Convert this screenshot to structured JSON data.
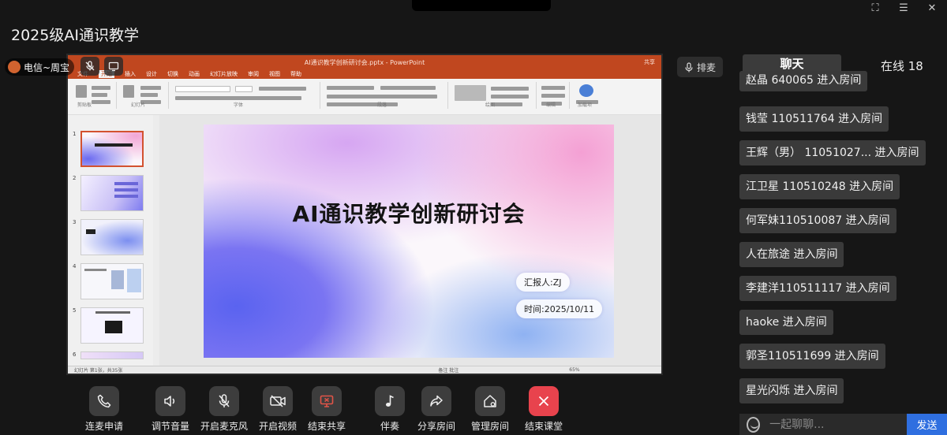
{
  "header": {
    "course_title": "2025级AI通识教学"
  },
  "presenter": {
    "name": "电信~周宝"
  },
  "ppt": {
    "window_title": "AI通识教学创新研讨会.pptx - PowerPoint",
    "share_label": "共享",
    "tabs": [
      "文件",
      "开始",
      "插入",
      "设计",
      "切换",
      "动画",
      "幻灯片放映",
      "审阅",
      "视图",
      "帮助"
    ],
    "ribbon_groups": [
      "剪贴板",
      "幻灯片",
      "字体",
      "段落",
      "绘图",
      "编辑",
      "加载项"
    ],
    "slide": {
      "title": "AI通识教学创新研讨会",
      "reporter": "汇报人:ZJ",
      "date": "时间:2025/10/11"
    },
    "thumbnail_numbers": [
      "1",
      "2",
      "3",
      "4",
      "5",
      "6"
    ],
    "status_left": "幻灯片 第1张，共35张",
    "status_right": "备注  批注",
    "zoom": "65%"
  },
  "side": {
    "raise_hand": "排麦",
    "chat_tab": "聊天",
    "online_label": "在线 18",
    "messages": [
      "赵晶 640065 进入房间",
      "钱莹 110511764 进入房间",
      "王辉（男） 11051027... 进入房间",
      "江卫星 110510248 进入房间",
      "何军妹110510087 进入房间",
      "人在旅途 进入房间",
      "李建洋110511117 进入房间",
      "haoke 进入房间",
      "郭圣110511699 进入房间",
      "星光闪烁 进入房间"
    ],
    "input_placeholder": "一起聊聊...",
    "send": "发送"
  },
  "controls": [
    {
      "label": "连麦申请",
      "icon": "phone-icon"
    },
    {
      "label": "调节音量",
      "icon": "speaker-icon"
    },
    {
      "label": "开启麦克风",
      "icon": "mic-off-icon"
    },
    {
      "label": "开启视频",
      "icon": "camera-off-icon"
    },
    {
      "label": "结束共享",
      "icon": "screen-share-icon"
    },
    {
      "label": "伴奏",
      "icon": "music-note-icon"
    },
    {
      "label": "分享房间",
      "icon": "share-arrow-icon"
    },
    {
      "label": "管理房间",
      "icon": "house-settings-icon"
    },
    {
      "label": "结束课堂",
      "icon": "close-icon"
    }
  ],
  "colors": {
    "background": "#161616",
    "ppt_accent": "#c0471f",
    "end_class": "#e8434d",
    "send_button": "#2f6fe0",
    "share_icon": "#e25548"
  }
}
